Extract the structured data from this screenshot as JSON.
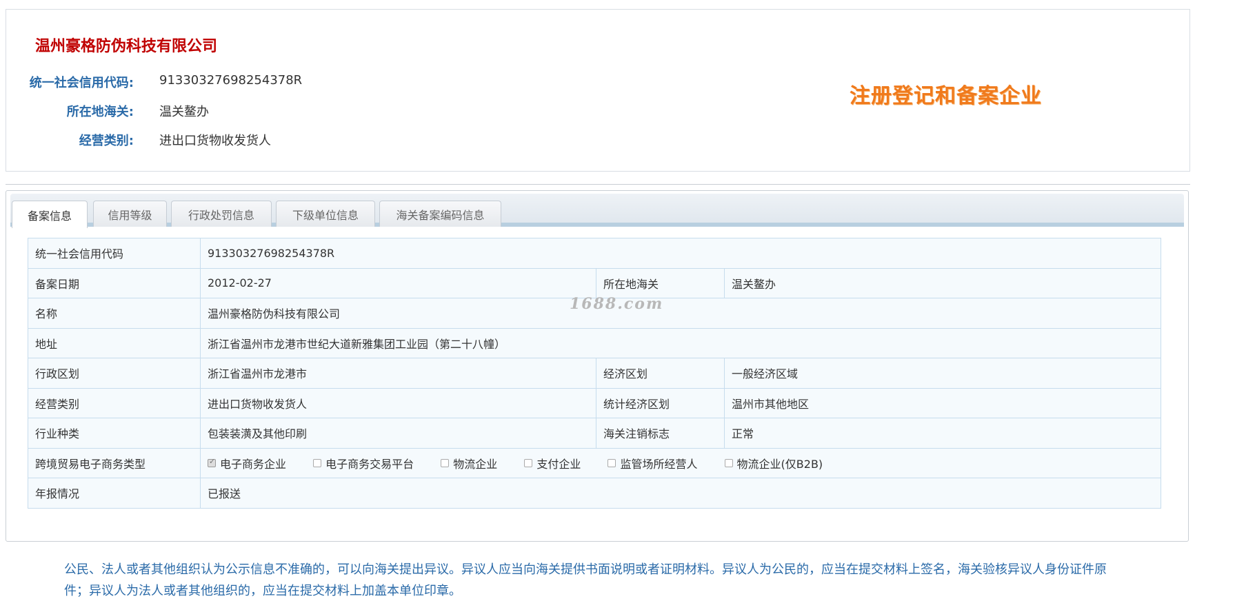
{
  "header": {
    "company_name": "温州豪格防伪科技有限公司",
    "rows": [
      {
        "label": "统一社会信用代码:",
        "value": "91330327698254378R"
      },
      {
        "label": "所在地海关:",
        "value": "温关鳌办"
      },
      {
        "label": "经营类别:",
        "value": "进出口货物收发货人"
      }
    ],
    "badge": "注册登记和备案企业"
  },
  "tabs": [
    {
      "label": "备案信息",
      "active": true
    },
    {
      "label": "信用等级",
      "active": false
    },
    {
      "label": "行政处罚信息",
      "active": false
    },
    {
      "label": "下级单位信息",
      "active": false
    },
    {
      "label": "海关备案编码信息",
      "active": false
    }
  ],
  "table": {
    "credit_code_label": "统一社会信用代码",
    "credit_code_value": "91330327698254378R",
    "record_date_label": "备案日期",
    "record_date_value": "2012-02-27",
    "customs_label": "所在地海关",
    "customs_value": "温关鳌办",
    "name_label": "名称",
    "name_value": "温州豪格防伪科技有限公司",
    "address_label": "地址",
    "address_value": "浙江省温州市龙港市世纪大道新雅集团工业园（第二十八幢）",
    "admin_region_label": "行政区划",
    "admin_region_value": "浙江省温州市龙港市",
    "econ_region_label": "经济区划",
    "econ_region_value": "一般经济区域",
    "biz_type_label": "经营类别",
    "biz_type_value": "进出口货物收发货人",
    "stat_region_label": "统计经济区划",
    "stat_region_value": "温州市其他地区",
    "industry_label": "行业种类",
    "industry_value": "包装装潢及其他印刷",
    "cancel_flag_label": "海关注销标志",
    "cancel_flag_value": "正常",
    "ecommerce_label": "跨境贸易电子商务类型",
    "ecommerce_options": [
      {
        "label": "电子商务企业",
        "checked": true
      },
      {
        "label": "电子商务交易平台",
        "checked": false
      },
      {
        "label": "物流企业",
        "checked": false
      },
      {
        "label": "支付企业",
        "checked": false
      },
      {
        "label": "监管场所经营人",
        "checked": false
      },
      {
        "label": "物流企业(仅B2B)",
        "checked": false
      }
    ],
    "annual_report_label": "年报情况",
    "annual_report_value": "已报送"
  },
  "watermark": "1688.com",
  "notice": "公民、法人或者其他组织认为公示信息不准确的，可以向海关提出异议。异议人应当向海关提供书面说明或者证明材料。异议人为公民的，应当在提交材料上签名，海关验核异议人身份证件原件；异议人为法人或者其他组织的，应当在提交材料上加盖本单位印章。"
}
